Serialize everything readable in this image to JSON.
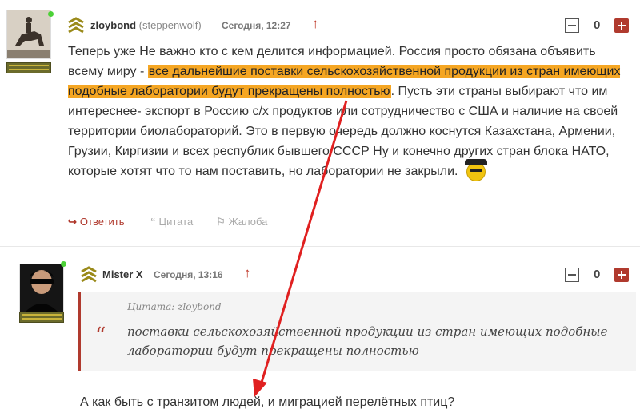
{
  "comment1": {
    "author": "zloybond",
    "nick": "(steppenwolf)",
    "date": "Сегодня, 12:27",
    "score": "0",
    "text_before": "Теперь уже Не важно кто с кем делится информацией. Россия просто обязана объявить всему миру - ",
    "text_highlight": "все дальнейшие поставки сельскохозяйственной продукции из стран имеющих подобные лаборатории будут прекращены полностью",
    "text_after": ". Пусть эти страны выбирают что им интереснее- экспорт в Россию с/х продуктов или сотрудничество с США и наличие на своей территории биолабораторий. Это в первую очередь должно коснутся Казахстана, Армении, Грузии, Киргизии и всех республик бывшего СССР Ну и конечно других стран блока НАТО, которые хотят что то нам поставить, но лаборатории не закрыли.",
    "actions": {
      "reply": "Ответить",
      "quote": "Цитата",
      "report": "Жалоба"
    }
  },
  "comment2": {
    "author": "Mister X",
    "date": "Сегодня, 13:16",
    "score": "0",
    "quote_title": "Цитата: zloybond",
    "quote_mark": "“",
    "quote_text": "поставки сельскохозяйственной продукции из стран имеющих подобные лаборатории будут прекращены полностью",
    "reply": "А как быть с транзитом людей, и миграцией перелётных птиц?"
  },
  "icons": {
    "rank": "chevron-rank-icon",
    "up": "arrow-up-icon",
    "reply": "reply-arrow-icon",
    "quote": "quote-icon",
    "report": "report-icon"
  },
  "colors": {
    "accent": "#b03a2e",
    "highlight": "#f5a623",
    "online": "#4cd137"
  }
}
